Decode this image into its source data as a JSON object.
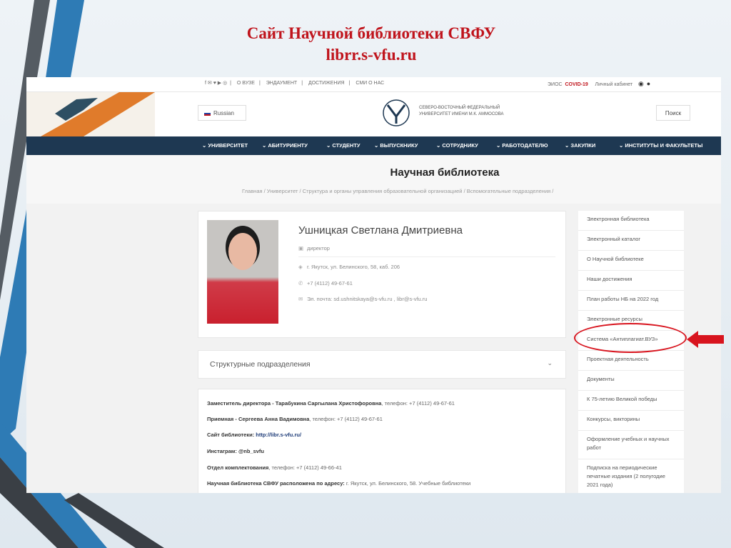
{
  "slide": {
    "title_line1": "Сайт Научной библиотеки СВФУ",
    "title_line2": "librr.s-vfu.ru"
  },
  "topbar": {
    "links": [
      "О ВУЗЕ",
      "ЭНДАУМЕНТ",
      "ДОСТИЖЕНИЯ",
      "СМИ О НАС"
    ],
    "eios": "ЭИОС",
    "covid": "COVID-19",
    "cabinet": "Личный кабинет"
  },
  "header": {
    "language": "Russian",
    "university_line1": "СЕВЕРО-ВОСТОЧНЫЙ ФЕДЕРАЛЬНЫЙ",
    "university_line2": "УНИВЕРСИТЕТ ИМЕНИ М.К. АММОСОВА",
    "search": "Поиск"
  },
  "nav": [
    "УНИВЕРСИТЕТ",
    "АБИТУРИЕНТУ",
    "СТУДЕНТУ",
    "ВЫПУСКНИКУ",
    "СОТРУДНИКУ",
    "РАБОТОДАТЕЛЮ",
    "ЗАКУПКИ",
    "ИНСТИТУТЫ И ФАКУЛЬТЕТЫ"
  ],
  "page": {
    "title": "Научная библиотека",
    "breadcrumb": "Главная  /  Университет  /  Структура и органы управления образовательной организацией  /  Вспомогательные подразделения  /"
  },
  "person": {
    "name": "Ушницкая Светлана Дмитриевна",
    "position": "директор",
    "address": "г. Якутск, ул. Белинского, 58, каб. 206",
    "phone": "+7 (4112) 49-67-61",
    "email": "Эл. почта: sd.ushnitskaya@s-vfu.ru , libr@s-vfu.ru"
  },
  "accordion": {
    "label": "Структурные подразделения"
  },
  "info": {
    "deputy_label": "Заместитель директора - Тарабукина Саргылана Христофоровна",
    "deputy_phone": ", телефон: +7 (4112) 49-67-61",
    "reception_label": "Приемная - Сергеева Анна Вадимовна",
    "reception_phone": ",  телефон: +7 (4112) 49-67-61",
    "site_label": "Сайт библиотеки: ",
    "site_url": "http://libr.s-vfu.ru/",
    "instagram": "Инстаграм: @nb_svfu",
    "acq_label": "Отдел комплектования",
    "acq_phone": ", телефон: +7 (4112) 49-66-41",
    "addr_label": "Научная библиотека СВФУ расположена по адресу:",
    "addr_text": " г. Якутск, ул. Белинского, 58. Учебные библиотеки"
  },
  "sidebar": [
    "Электронная библиотека",
    "Электронный каталог",
    "О Научной библиотеке",
    "Наши достижения",
    "План работы НБ на 2022 год",
    "Электронные ресурсы",
    "Система «Антиплагиат.ВУЗ»",
    "Проектная деятельность",
    "Документы",
    "К 75-летию Великой победы",
    "Конкурсы, викторины",
    "Оформление учебных и научных работ",
    "Подписка на периодические печатные издания (2 полугодие 2021 года)"
  ],
  "colors": {
    "title": "#c0141c",
    "nav": "#1e3852",
    "highlight": "#d8141e"
  }
}
